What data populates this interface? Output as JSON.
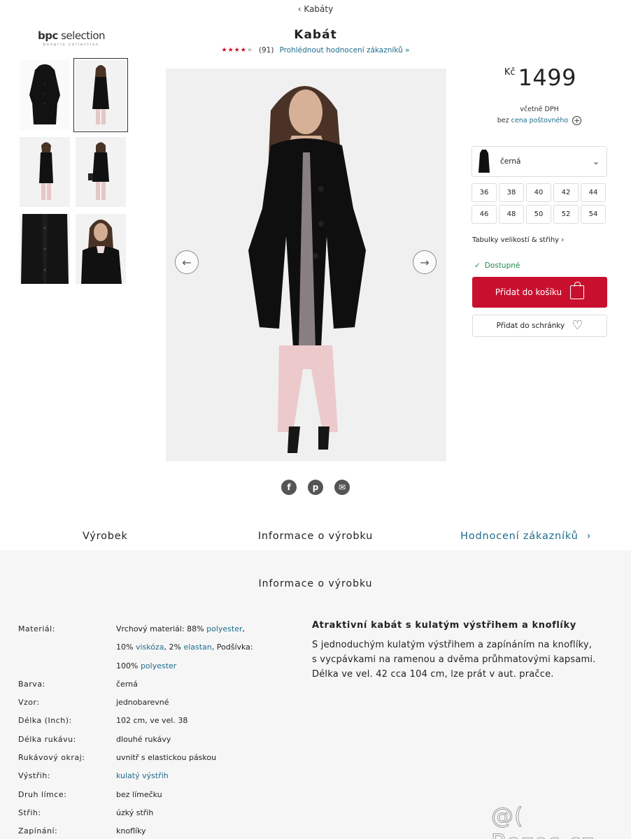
{
  "breadcrumb": {
    "label": "‹ Kabáty"
  },
  "brand": {
    "logo_bold": "bpc",
    "logo_rest": " selection",
    "tagline": "bonprix collection"
  },
  "product": {
    "title": "Kabát",
    "rating_stars": 4,
    "rating_count": "(91)",
    "rating_link": "Prohlédnout hodnocení zákazníků »"
  },
  "price": {
    "currency": "Kč",
    "amount": "1499",
    "vat_note": "včetně DPH",
    "shipping_prefix": "bez ",
    "shipping_link": "cena poštovného",
    "shipping_icon": "plus-circle"
  },
  "color": {
    "selected": "černá",
    "swatch_color": "#111111"
  },
  "sizes": [
    "36",
    "38",
    "40",
    "42",
    "44",
    "46",
    "48",
    "50",
    "52",
    "54"
  ],
  "size_table_link": "Tabulky velikostí & střihy  ›",
  "availability": "Dostupné",
  "buttons": {
    "add_to_cart": "Přidat do košíku",
    "add_to_wishlist": "Přidat do schránky"
  },
  "share_icons": [
    "facebook-icon",
    "pinterest-icon",
    "email-icon"
  ],
  "tabs": [
    {
      "label": "Výrobek"
    },
    {
      "label": "Informace o výrobku"
    },
    {
      "label": "Hodnocení zákazníků",
      "arrow": "›"
    }
  ],
  "info": {
    "heading": "Informace o výrobku",
    "attributes": [
      {
        "key": "Materiál:",
        "value_parts": [
          {
            "text": "Vrchový materiál: 88% "
          },
          {
            "text": "polyester",
            "link": true
          },
          {
            "text": ", 10% "
          },
          {
            "text": "viskóza",
            "link": true
          },
          {
            "text": ", 2% "
          },
          {
            "text": "elastan",
            "link": true
          },
          {
            "text": ", Podšívka: 100% "
          },
          {
            "text": "polyester",
            "link": true
          }
        ]
      },
      {
        "key": "Barva:",
        "value_parts": [
          {
            "text": "černá"
          }
        ]
      },
      {
        "key": "Vzor:",
        "value_parts": [
          {
            "text": "jednobarevné"
          }
        ]
      },
      {
        "key": "Délka (Inch):",
        "value_parts": [
          {
            "text": "102 cm, ve vel. 38"
          }
        ]
      },
      {
        "key": "Délka rukávu:",
        "value_parts": [
          {
            "text": "dlouhé rukávy"
          }
        ]
      },
      {
        "key": "Rukávový okraj:",
        "value_parts": [
          {
            "text": "uvnitř s elastickou páskou"
          }
        ]
      },
      {
        "key": "Výstřih:",
        "value_parts": [
          {
            "text": "kulatý výstřih",
            "link": true
          }
        ]
      },
      {
        "key": "Druh límce:",
        "value_parts": [
          {
            "text": "bez límečku"
          }
        ]
      },
      {
        "key": "Střih:",
        "value_parts": [
          {
            "text": "úzký střih"
          }
        ]
      },
      {
        "key": "Zapínání:",
        "value_parts": [
          {
            "text": "knoflíky"
          }
        ]
      }
    ],
    "desc_title": "Atraktivní kabát s kulatým výstřihem a knoflíky",
    "desc_text": "S jednoduchým kulatým výstřihem a zapínáním na knoflíky, s vycpávkami na ramenou a dvěma průhmatovými kapsami. Délka ve vel. 42 cca 104 cm, lze prát v aut. pračce."
  },
  "watermark": "@( Bazos.cz",
  "colors": {
    "accent": "#c8102e",
    "link": "#1c6c8c",
    "available": "#1f8a4c",
    "section_bg": "#f6f6f6"
  }
}
